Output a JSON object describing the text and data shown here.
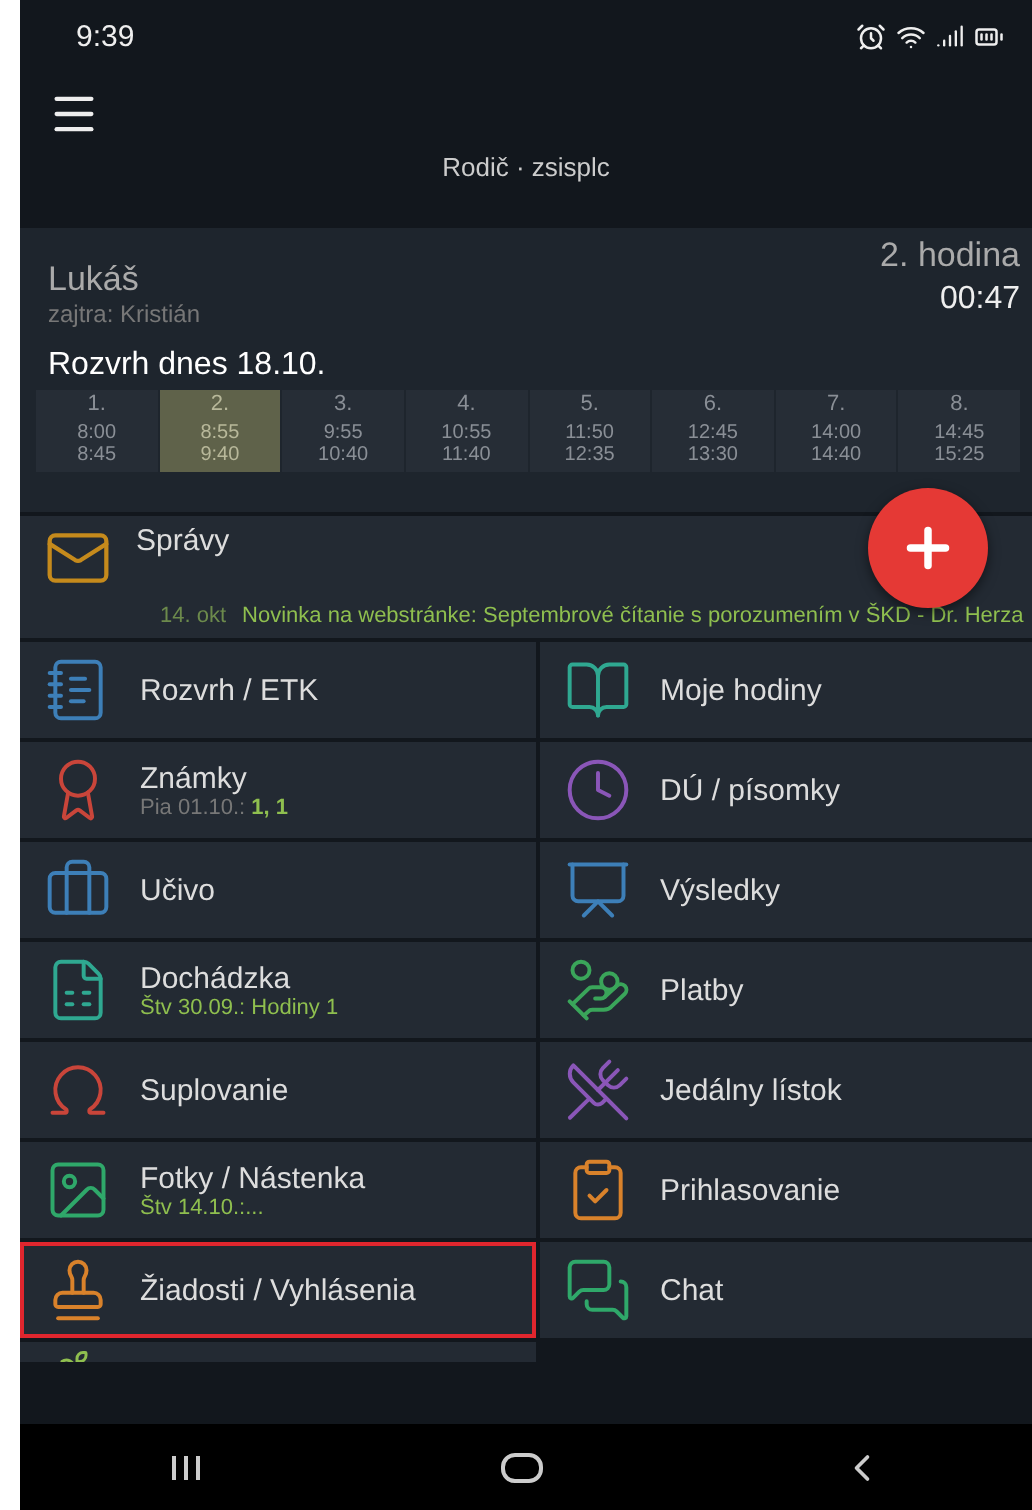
{
  "status_bar": {
    "time": "9:39"
  },
  "app_bar": {
    "title": "Rodič · zsisplc"
  },
  "student": {
    "name": "Lukáš",
    "next": "zajtra: Kristián",
    "lesson": "2. hodina",
    "countdown": "00:47"
  },
  "timetable": {
    "title": "Rozvrh dnes 18.10.",
    "periods": [
      {
        "number": "1.",
        "start": "8:00",
        "end": "8:45",
        "selected": false
      },
      {
        "number": "2.",
        "start": "8:55",
        "end": "9:40",
        "selected": true
      },
      {
        "number": "3.",
        "start": "9:55",
        "end": "10:40",
        "selected": false
      },
      {
        "number": "4.",
        "start": "10:55",
        "end": "11:40",
        "selected": false
      },
      {
        "number": "5.",
        "start": "11:50",
        "end": "12:35",
        "selected": false
      },
      {
        "number": "6.",
        "start": "12:45",
        "end": "13:30",
        "selected": false
      },
      {
        "number": "7.",
        "start": "14:00",
        "end": "14:40",
        "selected": false
      },
      {
        "number": "8.",
        "start": "14:45",
        "end": "15:25",
        "selected": false
      }
    ]
  },
  "messages": {
    "title": "Správy",
    "date": "14. okt",
    "text": "Novinka na webstránke: Septembrové čítanie s porozumením v ŠKD - Dr. Herza"
  },
  "tiles": [
    {
      "label": "Rozvrh / ETK",
      "color": "#3d7fb8",
      "selected": false
    },
    {
      "label": "Moje hodiny",
      "color": "#2fa891",
      "selected": false
    },
    {
      "label": "Známky",
      "subtitle": "Pia 01.10.: **1, 1**",
      "highlight": false,
      "color": "#c9453a",
      "selected": false
    },
    {
      "label": "DÚ / písomky",
      "color": "#8a56b8",
      "selected": false
    },
    {
      "label": "Učivo",
      "color": "#3d7fb8",
      "selected": false
    },
    {
      "label": "Výsledky",
      "color": "#3d7fb8",
      "selected": false
    },
    {
      "label": "Dochádzka",
      "subtitle": "Štv 30.09.: Hodiny 1",
      "highlight": true,
      "color": "#2fa891",
      "selected": false
    },
    {
      "label": "Platby",
      "color": "#3aa55a",
      "selected": false
    },
    {
      "label": "Suplovanie",
      "color": "#c9453a",
      "selected": false
    },
    {
      "label": "Jedálny lístok",
      "color": "#8a56b8",
      "selected": false
    },
    {
      "label": "Fotky / Nástenka",
      "subtitle": "Štv 14.10.:...",
      "highlight": true,
      "color": "#2fa86a",
      "selected": false
    },
    {
      "label": "Prihlasovanie",
      "color": "#d9822b",
      "selected": false
    },
    {
      "label": "Žiadosti / Vyhlásenia",
      "color": "#d9822b",
      "selected": true
    },
    {
      "label": "Chat",
      "color": "#2fa86a",
      "selected": false
    }
  ]
}
